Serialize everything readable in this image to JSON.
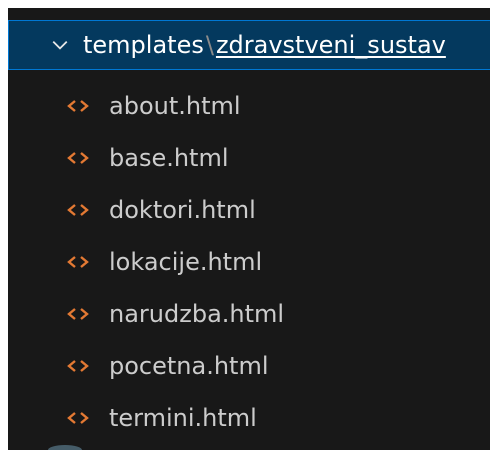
{
  "explorer": {
    "folder": {
      "name": "templates",
      "separator": "\\",
      "subfolder": "zdravstveni_sustav",
      "expanded": true,
      "icon": "chevron-down-icon"
    },
    "files": [
      {
        "label": "about.html",
        "icon": "html-file-icon"
      },
      {
        "label": "base.html",
        "icon": "html-file-icon"
      },
      {
        "label": "doktori.html",
        "icon": "html-file-icon"
      },
      {
        "label": "lokacije.html",
        "icon": "html-file-icon"
      },
      {
        "label": "narudzba.html",
        "icon": "html-file-icon"
      },
      {
        "label": "pocetna.html",
        "icon": "html-file-icon"
      },
      {
        "label": "termini.html",
        "icon": "html-file-icon"
      }
    ]
  },
  "colors": {
    "background": "#181818",
    "selected_background": "#04395e",
    "selected_border": "#0078d4",
    "text": "#cccccc",
    "html_icon": "#e37933"
  }
}
